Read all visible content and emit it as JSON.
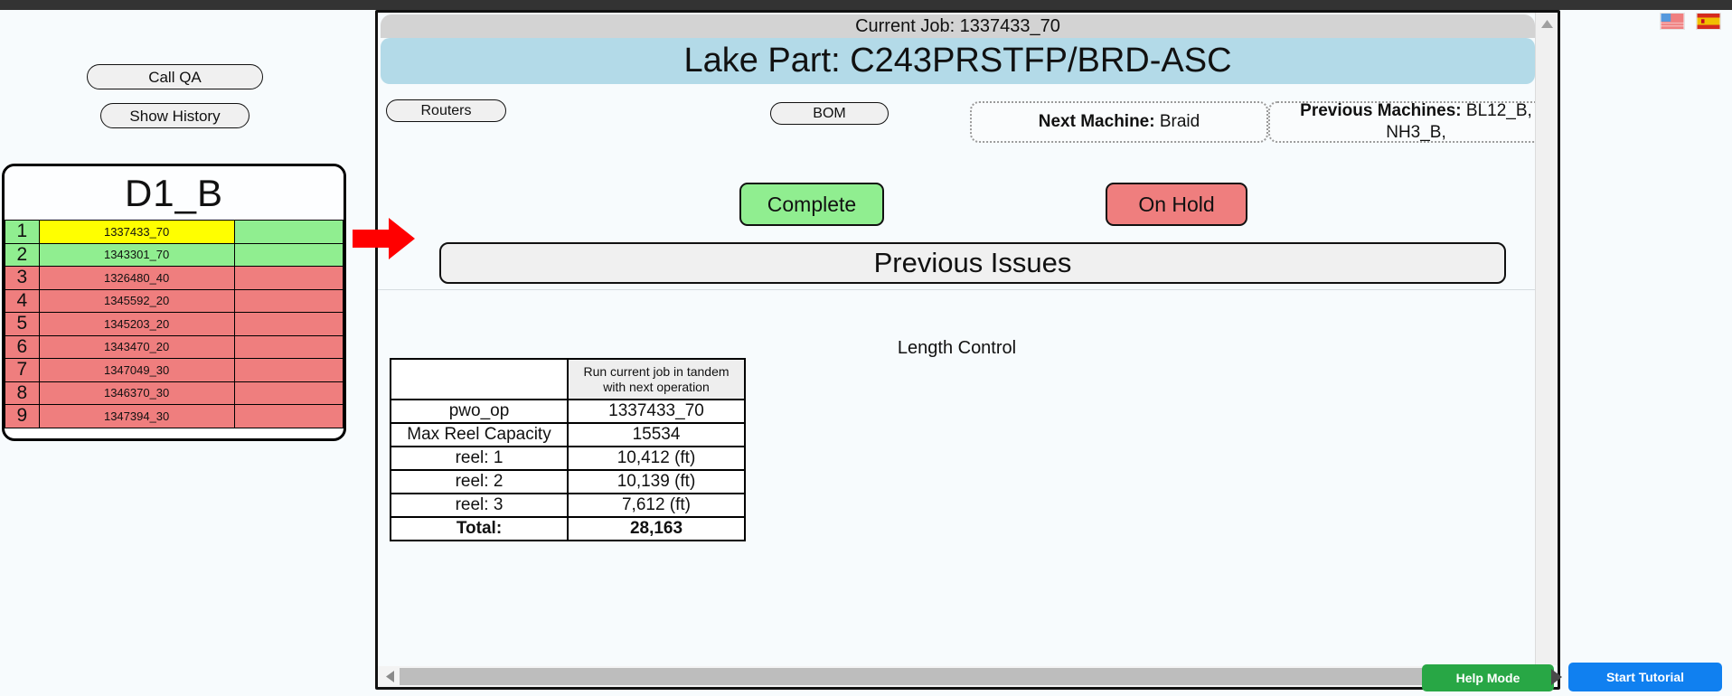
{
  "left_panel": {
    "call_qa_label": "Call QA",
    "show_history_label": "Show History",
    "queue": {
      "title": "D1_B",
      "rows": [
        {
          "index": "1",
          "job": "1337433_70",
          "state": "current"
        },
        {
          "index": "2",
          "job": "1343301_70",
          "state": "ready"
        },
        {
          "index": "3",
          "job": "1326480_40",
          "state": "blocked"
        },
        {
          "index": "4",
          "job": "1345592_20",
          "state": "blocked"
        },
        {
          "index": "5",
          "job": "1345203_20",
          "state": "blocked"
        },
        {
          "index": "6",
          "job": "1343470_20",
          "state": "blocked"
        },
        {
          "index": "7",
          "job": "1347049_30",
          "state": "blocked"
        },
        {
          "index": "8",
          "job": "1346370_30",
          "state": "blocked"
        },
        {
          "index": "9",
          "job": "1347394_30",
          "state": "blocked"
        }
      ]
    }
  },
  "main": {
    "current_job": "Current Job: 1337433_70",
    "lake_part": "Lake Part: C243PRSTFP/BRD-ASC",
    "routers_label": "Routers",
    "bom_label": "BOM",
    "next_machine_label": "Next Machine:",
    "next_machine_value": "Braid",
    "previous_machines_label": "Previous Machines:",
    "previous_machines_value": "BL12_B, NH3_B,",
    "complete_label": "Complete",
    "on_hold_label": "On Hold",
    "previous_issues_label": "Previous Issues",
    "length_control_label": "Length Control",
    "length_control_table": {
      "header_blank": "",
      "header_note": "Run current job in tandem with next operation",
      "rows": [
        {
          "label": "pwo_op",
          "value": "1337433_70"
        },
        {
          "label": "Max Reel Capacity",
          "value": "15534"
        },
        {
          "label": "reel: 1",
          "value": "10,412 (ft)"
        },
        {
          "label": "reel: 2",
          "value": "10,139 (ft)"
        },
        {
          "label": "reel: 3",
          "value": "7,612 (ft)"
        }
      ],
      "total_label": "Total:",
      "total_value": "28,163"
    }
  },
  "footer": {
    "help_mode_label": "Help Mode",
    "start_tutorial_label": "Start Tutorial"
  },
  "icons": {
    "flag_us": "us-flag-icon",
    "flag_es": "spain-flag-icon",
    "scroll_up": "scroll-up-arrow-icon",
    "scroll_left": "scroll-left-arrow-icon",
    "pointer": "red-right-arrow-icon"
  },
  "colors": {
    "ready": "#90ee90",
    "blocked": "#ef7e7e",
    "current": "#ffff00",
    "header_band": "#b3dae8",
    "help_mode": "#28a745",
    "start_tutorial": "#1080f0",
    "pointer": "#ff0000"
  }
}
